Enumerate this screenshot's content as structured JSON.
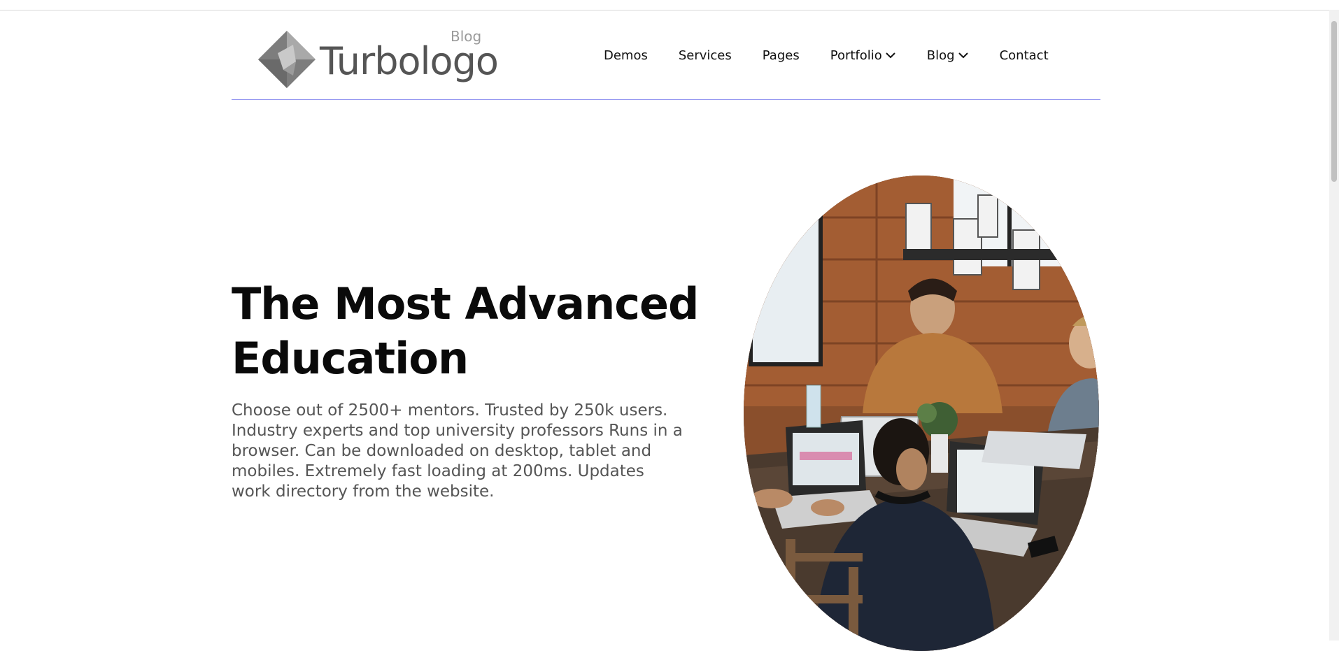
{
  "logo": {
    "word": "Turbologo",
    "tag": "Blog",
    "icon": "diamond-logo-icon"
  },
  "nav": {
    "items": [
      {
        "label": "Demos",
        "has_dropdown": false
      },
      {
        "label": "Services",
        "has_dropdown": false
      },
      {
        "label": "Pages",
        "has_dropdown": false
      },
      {
        "label": "Portfolio",
        "has_dropdown": true
      },
      {
        "label": "Blog",
        "has_dropdown": true
      },
      {
        "label": "Contact",
        "has_dropdown": false
      }
    ]
  },
  "hero": {
    "title_line1": "The Most Advanced",
    "title_line2": "Education",
    "text_line1": "Choose out of 2500+ mentors. Trusted by 250k users.",
    "text_line2": "Industry experts and top university professors Runs in a",
    "text_line3": "browser. Can be downloaded on desktop, tablet and",
    "text_line4": "mobiles. Extremely fast loading at 200ms. Updates",
    "text_line5": "work directory from the website.",
    "image": "people-working-at-laptops-photo"
  },
  "colors": {
    "header_rule": "#8c8ff0",
    "title": "#0a0a0a",
    "body_text": "#555555"
  }
}
